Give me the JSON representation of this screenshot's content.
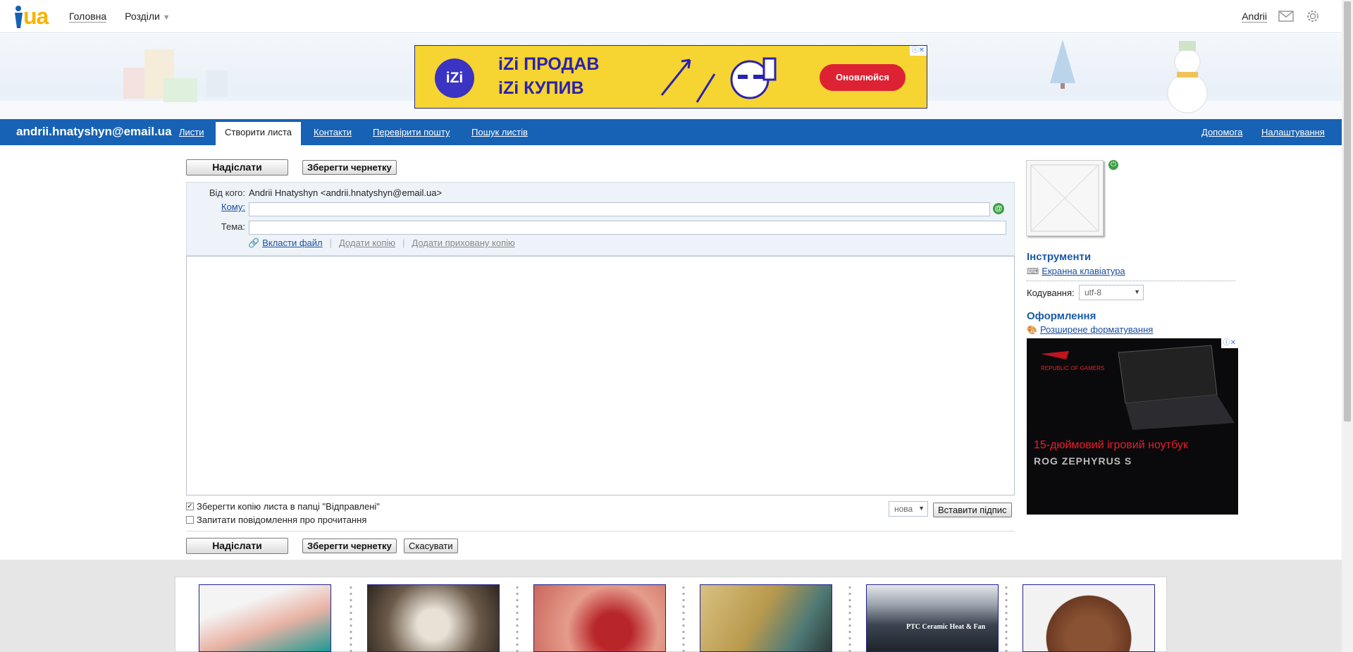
{
  "topbar": {
    "logo_text": "ua",
    "nav": [
      "Головна",
      "Розділи"
    ],
    "user": "Andrii"
  },
  "ad_top": {
    "logo": "iZi",
    "line1": "iZi ПРОДАВ",
    "line2": "iZi КУПИВ",
    "cta": "Оновлюйся"
  },
  "mailnav": {
    "email": "andrii.hnatyshyn@email.ua",
    "tabs": [
      "Листи",
      "Створити листа",
      "Контакти",
      "Перевірити пошту",
      "Пошук листів"
    ],
    "right_tabs": [
      "Допомога",
      "Налаштування"
    ]
  },
  "compose": {
    "send_label": "Надіслати",
    "save_draft_label": "Зберегти чернетку",
    "cancel_label": "Скасувати",
    "from_label": "Від кого:",
    "from_value": "Andrii Hnatyshyn <andrii.hnatyshyn@email.ua>",
    "to_label": "Кому:",
    "to_value": "",
    "subject_label": "Тема:",
    "subject_value": "",
    "attach_label": "Вкласти файл",
    "add_cc_label": "Додати копію",
    "add_bcc_label": "Додати приховану копію",
    "body_value": "",
    "save_copy_label": "Зберегти копію листа в папці \"Відправлені\"",
    "save_copy_checked": true,
    "read_receipt_label": "Запитати повідомлення про прочитання",
    "read_receipt_checked": false,
    "signature_select": "нова",
    "insert_signature_label": "Вставити підпис"
  },
  "sidebar": {
    "tools_heading": "Інструменти",
    "keyboard_link": "Екранна клавіатура",
    "encoding_label": "Кодування:",
    "encoding_value": "utf-8",
    "design_heading": "Оформлення",
    "formatting_link": "Розширене форматування"
  },
  "ad_side": {
    "brand": "REPUBLIC OF GAMERS",
    "line1": "15-дюймовий ігровий ноутбук",
    "line2": "ROG ZEPHYRUS S"
  },
  "thumbnails": [
    {
      "name": "sneaker-thumbnail",
      "color": "#e9b3a5"
    },
    {
      "name": "mushrooms-thumbnail",
      "color": "#6b5a4a"
    },
    {
      "name": "artery-thumbnail",
      "color": "#c9665a"
    },
    {
      "name": "cheese-thumbnail",
      "color": "#b99a4d"
    },
    {
      "name": "heater-thumbnail",
      "color": "#3b4450",
      "text": "PTC Ceramic Heat & Fan"
    },
    {
      "name": "bag-thumbnail",
      "color": "#6b3a22"
    }
  ],
  "colors": {
    "brand_blue": "#1762b4",
    "logo_yellow": "#f5b400",
    "link": "#1a4fa0"
  }
}
